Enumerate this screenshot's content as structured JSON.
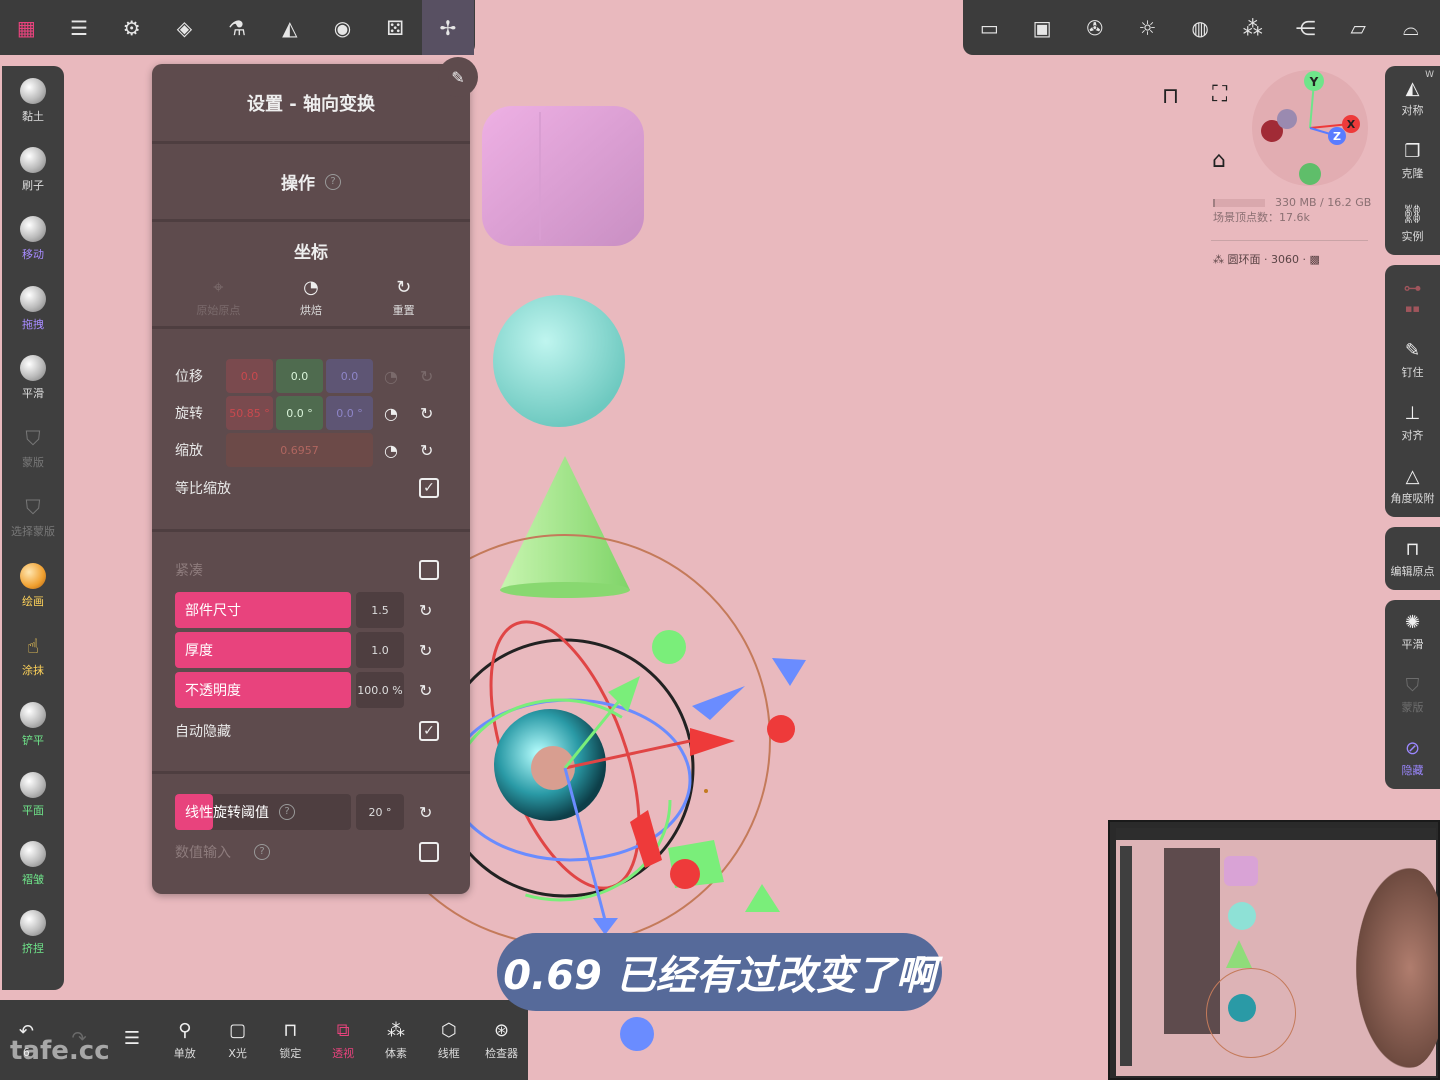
{
  "colors": {
    "accent": "#e8437d",
    "panel": "#5e4b4d",
    "toolbar": "#3c3c3c",
    "viewport": "#e9b9be"
  },
  "top_left_icons": [
    "grid-logo-icon",
    "sliders-icon",
    "gear-icon",
    "layers-icon",
    "flask-icon",
    "symmetry-icon",
    "palette-icon",
    "dice-icon",
    "transform-gizmo-icon"
  ],
  "top_right_icons": [
    "camera-icon",
    "image-icon",
    "aperture-icon",
    "sun-icon",
    "sphere-icon",
    "cubes-icon",
    "share-icon",
    "folder-icon",
    "hat-icon"
  ],
  "left_tools": [
    "黏土",
    "刷子",
    "移动",
    "拖拽",
    "平滑",
    "蒙版",
    "选择蒙版",
    "绘画",
    "涂抹",
    "铲平",
    "平面",
    "褶皱",
    "挤捏"
  ],
  "right_tools": {
    "symmetry": "对称",
    "clone": "克隆",
    "instance": "实例",
    "pin": "钉住",
    "align": "对齐",
    "angle_snap": "角度吸附",
    "edit_origin": "编辑原点",
    "smooth": "平滑",
    "mask": "蒙版",
    "hide": "隐藏",
    "w_badge": "W"
  },
  "bottom_tools": [
    "单放",
    "X光",
    "锁定",
    "透视",
    "体素",
    "线框",
    "检查器"
  ],
  "bottom_undo_count": "6",
  "watermark": "tafe.cc",
  "panel": {
    "title": "设置 - 轴向变换",
    "operation": "操作",
    "coord_title": "坐标",
    "coord_btn_dim": "原始原点",
    "coord_bake": "烘焙",
    "coord_reset": "重置",
    "translate_label": "位移",
    "translate": {
      "x": "0.0",
      "y": "0.0",
      "z": "0.0"
    },
    "rotate_label": "旋转",
    "rotate": {
      "x": "50.85 °",
      "y": "0.0 °",
      "z": "0.0 °"
    },
    "scale_label": "缩放",
    "scale": "0.6957",
    "uniform_scale": "等比缩放",
    "compact": "紧凑",
    "part_size": "部件尺寸",
    "part_size_value": "1.5",
    "thickness": "厚度",
    "thickness_value": "1.0",
    "opacity": "不透明度",
    "opacity_value": "100.0 %",
    "auto_hide": "自动隐藏",
    "linear_rot_threshold": "线性旋转阈值",
    "linear_rot_value": "20 °",
    "numeric_input": "数值输入"
  },
  "hud": {
    "memory": "330 MB / 16.2 GB",
    "vertex_count": "场景顶点数：17.6k",
    "selection": "圆环面 · 3060 ·",
    "gizmo_axes": [
      "Y",
      "X",
      "Z"
    ]
  },
  "subtitle": "0.69 已经有过改变了啊"
}
